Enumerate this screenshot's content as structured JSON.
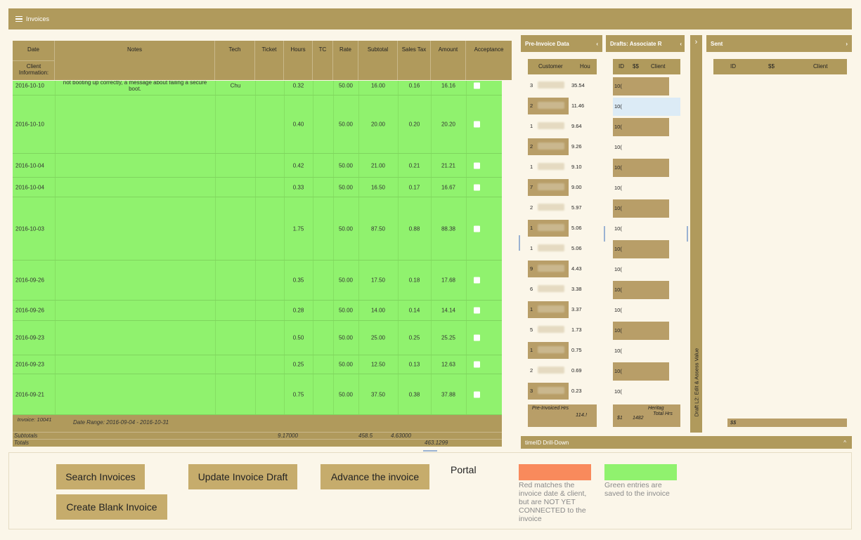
{
  "topbar": {
    "title": "Invoices"
  },
  "table": {
    "headers": [
      "Date",
      "Notes",
      "Tech",
      "Ticket",
      "Hours",
      "TC",
      "Rate",
      "Subtotal",
      "Sales Tax",
      "Amount",
      "Acceptance"
    ],
    "client_info_label": "Client Information:",
    "rows": [
      {
        "date": "2016-10-10",
        "notes": "not booting up correctly, a message about failing a secure boot.",
        "tech": "Chu",
        "hours": "0.32",
        "rate": "50.00",
        "subtotal": "16.00",
        "tax": "0.16",
        "amount": "16.16"
      },
      {
        "date": "2016-10-10",
        "notes": "",
        "tech": "",
        "hours": "0.40",
        "rate": "50.00",
        "subtotal": "20.00",
        "tax": "0.20",
        "amount": "20.20"
      },
      {
        "date": "2016-10-04",
        "notes": "",
        "tech": "",
        "hours": "0.42",
        "rate": "50.00",
        "subtotal": "21.00",
        "tax": "0.21",
        "amount": "21.21"
      },
      {
        "date": "2016-10-04",
        "notes": "",
        "tech": "",
        "hours": "0.33",
        "rate": "50.00",
        "subtotal": "16.50",
        "tax": "0.17",
        "amount": "16.67"
      },
      {
        "date": "2016-10-03",
        "notes": "",
        "tech": "",
        "hours": "1.75",
        "rate": "50.00",
        "subtotal": "87.50",
        "tax": "0.88",
        "amount": "88.38"
      },
      {
        "date": "2016-09-26",
        "notes": "",
        "tech": "",
        "hours": "0.35",
        "rate": "50.00",
        "subtotal": "17.50",
        "tax": "0.18",
        "amount": "17.68"
      },
      {
        "date": "2016-09-26",
        "notes": "",
        "tech": "",
        "hours": "0.28",
        "rate": "50.00",
        "subtotal": "14.00",
        "tax": "0.14",
        "amount": "14.14"
      },
      {
        "date": "2016-09-23",
        "notes": "",
        "tech": "",
        "hours": "0.50",
        "rate": "50.00",
        "subtotal": "25.00",
        "tax": "0.25",
        "amount": "25.25"
      },
      {
        "date": "2016-09-23",
        "notes": "",
        "tech": "",
        "hours": "0.25",
        "rate": "50.00",
        "subtotal": "12.50",
        "tax": "0.13",
        "amount": "12.63"
      },
      {
        "date": "2016-09-21",
        "notes": "",
        "tech": "",
        "hours": "0.75",
        "rate": "50.00",
        "subtotal": "37.50",
        "tax": "0.38",
        "amount": "37.88"
      }
    ],
    "footer": {
      "invoice_label": "Invoice: 10041",
      "date_range": "Date Range: 2016-09-04 - 2016-10-31",
      "subtotals_label": "Subtotals",
      "subtotal_hours": "9.17000",
      "subtotal_amount": "458.5",
      "subtotal_tax": "4.63000",
      "totals_label": "Totals",
      "total_amount": "463.1299"
    }
  },
  "pre_invoice": {
    "title": "Pre-Invoice Data",
    "col_customer": "Customer",
    "col_hours": "Hou",
    "rows": [
      {
        "c": "3",
        "h": "35.54"
      },
      {
        "c": "2",
        "h": "11.46"
      },
      {
        "c": "1",
        "h": "9.64"
      },
      {
        "c": "2",
        "h": "9.26"
      },
      {
        "c": "1",
        "h": "9.10"
      },
      {
        "c": "7",
        "h": "9.00"
      },
      {
        "c": "2",
        "h": "5.97"
      },
      {
        "c": "1",
        "h": "5.06"
      },
      {
        "c": "1",
        "h": "5.06"
      },
      {
        "c": "9",
        "h": "4.43"
      },
      {
        "c": "6",
        "h": "3.38"
      },
      {
        "c": "1",
        "h": "3.37"
      },
      {
        "c": "5",
        "h": "1.73"
      },
      {
        "c": "1",
        "h": "0.75"
      },
      {
        "c": "2",
        "h": "0.69"
      },
      {
        "c": "3",
        "h": "0.23"
      }
    ],
    "footer_label": "Pre-Invoiced Hrs",
    "footer_value": "114.!"
  },
  "drafts": {
    "title": "Drafts: Associate R",
    "col_id": "ID",
    "col_ss": "$$",
    "col_client": "Client",
    "rows": [
      "10(",
      "10(",
      "10(",
      "10(",
      "10(",
      "10(",
      "10(",
      "10(",
      "10(",
      "10(",
      "10(",
      "10(",
      "10(",
      "10(",
      "10(",
      "10("
    ],
    "footer_ss": "$1",
    "footer_value": "1482",
    "footer_label": "Total Hrs",
    "footer_client": "Heritag"
  },
  "vertical_label": "Draft L2: Edit & Assess Value",
  "sent": {
    "title": "Sent",
    "col_id": "ID",
    "col_ss": "$$",
    "col_client": "Client",
    "footer_ss": "$$"
  },
  "drilldown": {
    "title": "timeID Drill-Down"
  },
  "buttons": {
    "search": "Search Invoices",
    "update": "Update Invoice Draft",
    "advance": "Advance the invoice",
    "create": "Create Blank Invoice"
  },
  "portal_label": "Portal",
  "legend": {
    "red_text": "Red matches the invoice date & client, but are NOT YET CONNECTED to the invoice",
    "green_text": "Green entries are saved to the invoice",
    "red_color": "#f98a5c",
    "green_color": "#90f26e"
  }
}
